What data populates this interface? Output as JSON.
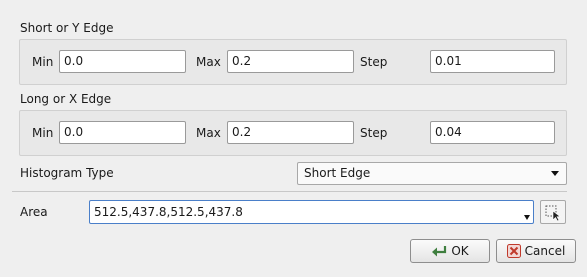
{
  "short_edge": {
    "title": "Short or Y Edge",
    "min_label": "Min",
    "min_value": "0.0",
    "max_label": "Max",
    "max_value": "0.2",
    "step_label": "Step",
    "step_value": "0.01"
  },
  "long_edge": {
    "title": "Long or X Edge",
    "min_label": "Min",
    "min_value": "0.0",
    "max_label": "Max",
    "max_value": "0.2",
    "step_label": "Step",
    "step_value": "0.04"
  },
  "histogram": {
    "label": "Histogram Type",
    "selected": "Short Edge"
  },
  "area": {
    "label": "Area",
    "value": "512.5,437.8,512.5,437.8",
    "tool_icon": "select-area-icon"
  },
  "buttons": {
    "ok_label": "OK",
    "cancel_label": "Cancel"
  },
  "colors": {
    "focus_border": "#4a7fc9",
    "cancel_icon": "#c0392b",
    "ok_icon": "#3f7f3f"
  }
}
